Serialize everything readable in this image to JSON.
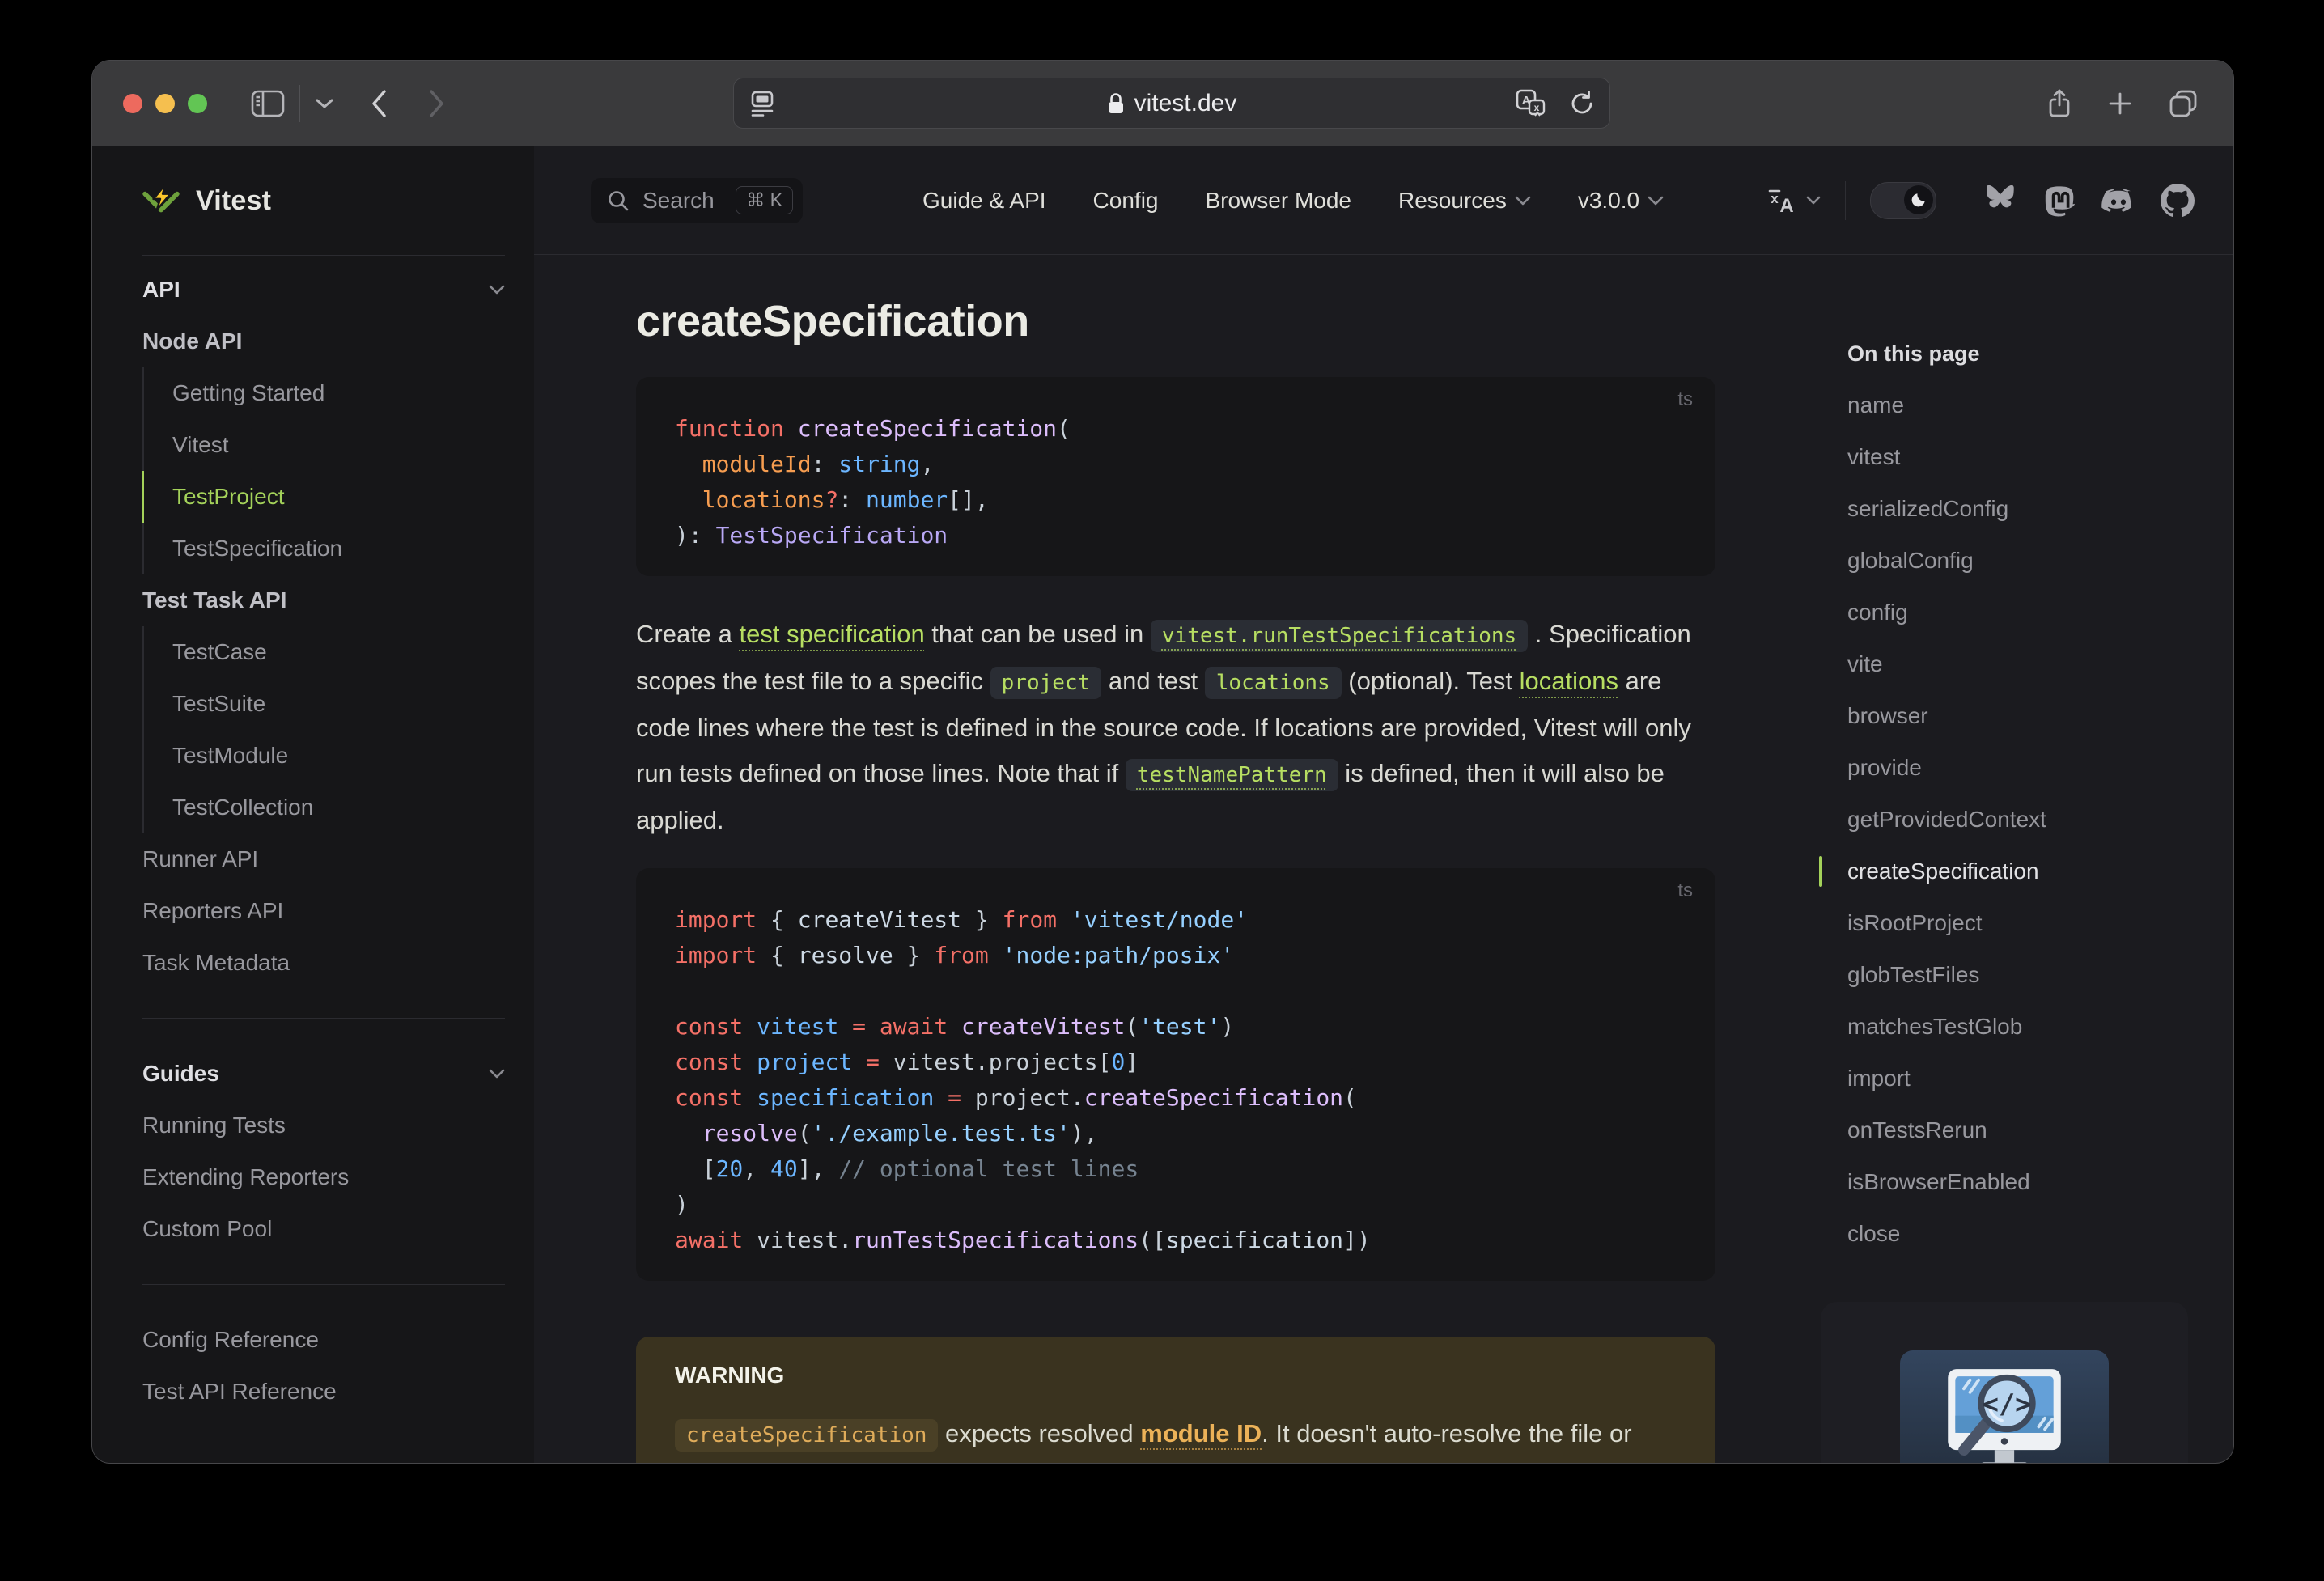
{
  "colors": {
    "accent": "#b7de62",
    "sidebar_active": "#a4d25a",
    "warning_accent": "#ecb258",
    "brand_bolt": "#fcc72b",
    "brand_chevron": "#6ea13c"
  },
  "browser": {
    "url": "vitest.dev"
  },
  "topnav": {
    "search_label": "Search",
    "search_kbd": "⌘ K",
    "links": [
      "Guide & API",
      "Config",
      "Browser Mode"
    ],
    "menus": [
      "Resources",
      "v3.0.0"
    ]
  },
  "sidebar": {
    "logo_text": "Vitest",
    "sections": [
      {
        "kind": "group-title",
        "label": "API"
      },
      {
        "kind": "section",
        "label": "Node API"
      },
      {
        "kind": "item",
        "label": "Getting Started",
        "indent": true
      },
      {
        "kind": "item",
        "label": "Vitest",
        "indent": true
      },
      {
        "kind": "item",
        "label": "TestProject",
        "indent": true,
        "active": true
      },
      {
        "kind": "item",
        "label": "TestSpecification",
        "indent": true
      },
      {
        "kind": "section",
        "label": "Test Task API"
      },
      {
        "kind": "item",
        "label": "TestCase",
        "indent": true
      },
      {
        "kind": "item",
        "label": "TestSuite",
        "indent": true
      },
      {
        "kind": "item",
        "label": "TestModule",
        "indent": true
      },
      {
        "kind": "item",
        "label": "TestCollection",
        "indent": true
      },
      {
        "kind": "item",
        "label": "Runner API"
      },
      {
        "kind": "item",
        "label": "Reporters API"
      },
      {
        "kind": "item",
        "label": "Task Metadata"
      },
      {
        "kind": "divider"
      },
      {
        "kind": "group-title",
        "label": "Guides"
      },
      {
        "kind": "item",
        "label": "Running Tests"
      },
      {
        "kind": "item",
        "label": "Extending Reporters"
      },
      {
        "kind": "item",
        "label": "Custom Pool"
      },
      {
        "kind": "divider"
      },
      {
        "kind": "item",
        "label": "Config Reference"
      },
      {
        "kind": "item",
        "label": "Test API Reference"
      }
    ]
  },
  "article": {
    "heading": "createSpecification",
    "code_blocks": [
      {
        "lang": "ts",
        "lines": [
          [
            [
              "kw",
              "function"
            ],
            [
              "pl",
              " "
            ],
            [
              "fn",
              "createSpecification"
            ],
            [
              "pl",
              "("
            ]
          ],
          [
            [
              "pl",
              "  "
            ],
            [
              "or",
              "moduleId"
            ],
            [
              "pl",
              ": "
            ],
            [
              "va",
              "string"
            ],
            [
              "pl",
              ","
            ]
          ],
          [
            [
              "pl",
              "  "
            ],
            [
              "or",
              "locations"
            ],
            [
              "kw",
              "?"
            ],
            [
              "pl",
              ": "
            ],
            [
              "va",
              "number"
            ],
            [
              "pl",
              "[],"
            ]
          ],
          [
            [
              "pl",
              "): "
            ],
            [
              "ty",
              "TestSpecification"
            ]
          ]
        ]
      },
      {
        "lang": "ts",
        "lines": [
          [
            [
              "kw",
              "import"
            ],
            [
              "pl",
              " { "
            ],
            [
              "tx",
              "createVitest"
            ],
            [
              "pl",
              " } "
            ],
            [
              "kw",
              "from"
            ],
            [
              "st",
              " 'vitest/node'"
            ]
          ],
          [
            [
              "kw",
              "import"
            ],
            [
              "pl",
              " { "
            ],
            [
              "tx",
              "resolve"
            ],
            [
              "pl",
              " } "
            ],
            [
              "kw",
              "from"
            ],
            [
              "st",
              " 'node:path/posix'"
            ]
          ],
          [],
          [
            [
              "kw",
              "const"
            ],
            [
              "va",
              " vitest"
            ],
            [
              "kw",
              " ="
            ],
            [
              "kw",
              " await"
            ],
            [
              "fn",
              " createVitest"
            ],
            [
              "pl",
              "("
            ],
            [
              "st",
              "'test'"
            ],
            [
              "pl",
              ")"
            ]
          ],
          [
            [
              "kw",
              "const"
            ],
            [
              "va",
              " project"
            ],
            [
              "kw",
              " ="
            ],
            [
              "pl",
              " vitest.projects["
            ],
            [
              "nu",
              "0"
            ],
            [
              "pl",
              "]"
            ]
          ],
          [
            [
              "kw",
              "const"
            ],
            [
              "va",
              " specification"
            ],
            [
              "kw",
              " ="
            ],
            [
              "pl",
              " project."
            ],
            [
              "fn",
              "createSpecification"
            ],
            [
              "pl",
              "("
            ]
          ],
          [
            [
              "pl",
              "  "
            ],
            [
              "fn",
              "resolve"
            ],
            [
              "pl",
              "("
            ],
            [
              "st",
              "'./example.test.ts'"
            ],
            [
              "pl",
              "),"
            ]
          ],
          [
            [
              "pl",
              "  ["
            ],
            [
              "nu",
              "20"
            ],
            [
              "pl",
              ", "
            ],
            [
              "nu",
              "40"
            ],
            [
              "pl",
              "], "
            ],
            [
              "cm",
              "// optional test lines"
            ]
          ],
          [
            [
              "pl",
              ")"
            ]
          ],
          [
            [
              "kw",
              "await"
            ],
            [
              "pl",
              " vitest."
            ],
            [
              "fn",
              "runTestSpecifications"
            ],
            [
              "pl",
              "(["
            ],
            [
              "tx",
              "specification"
            ],
            [
              "pl",
              "])"
            ]
          ]
        ]
      }
    ],
    "paragraph": [
      {
        "k": "text",
        "t": "Create a "
      },
      {
        "k": "link",
        "t": "test specification"
      },
      {
        "k": "text",
        "t": " that can be used in "
      },
      {
        "k": "codelink",
        "t": "vitest.runTestSpecifications"
      },
      {
        "k": "text",
        "t": " . Specification scopes the test file to a specific "
      },
      {
        "k": "code",
        "t": "project"
      },
      {
        "k": "text",
        "t": " and test "
      },
      {
        "k": "code",
        "t": "locations"
      },
      {
        "k": "text",
        "t": " (optional). Test "
      },
      {
        "k": "link",
        "t": "locations"
      },
      {
        "k": "text",
        "t": " are code lines where the test is defined in the source code. If locations are provided, Vitest will only run tests defined on those lines. Note that if "
      },
      {
        "k": "codelink",
        "t": "testNamePattern"
      },
      {
        "k": "text",
        "t": " is defined, then it will also be applied."
      }
    ],
    "warning": {
      "title": "WARNING",
      "segments": [
        {
          "k": "wcode",
          "t": "createSpecification"
        },
        {
          "k": "text",
          "t": " expects resolved "
        },
        {
          "k": "wlink",
          "t": "module ID"
        },
        {
          "k": "text",
          "t": ". It doesn't auto-resolve the file or check that it exists on the file system."
        }
      ]
    }
  },
  "outline": {
    "title": "On this page",
    "items": [
      "name",
      "vitest",
      "serializedConfig",
      "globalConfig",
      "config",
      "vite",
      "browser",
      "provide",
      "getProvidedContext",
      "createSpecification",
      "isRootProject",
      "globTestFiles",
      "matchesTestGlob",
      "import",
      "onTestsRerun",
      "isBrowserEnabled",
      "close"
    ],
    "active_index": 9
  }
}
